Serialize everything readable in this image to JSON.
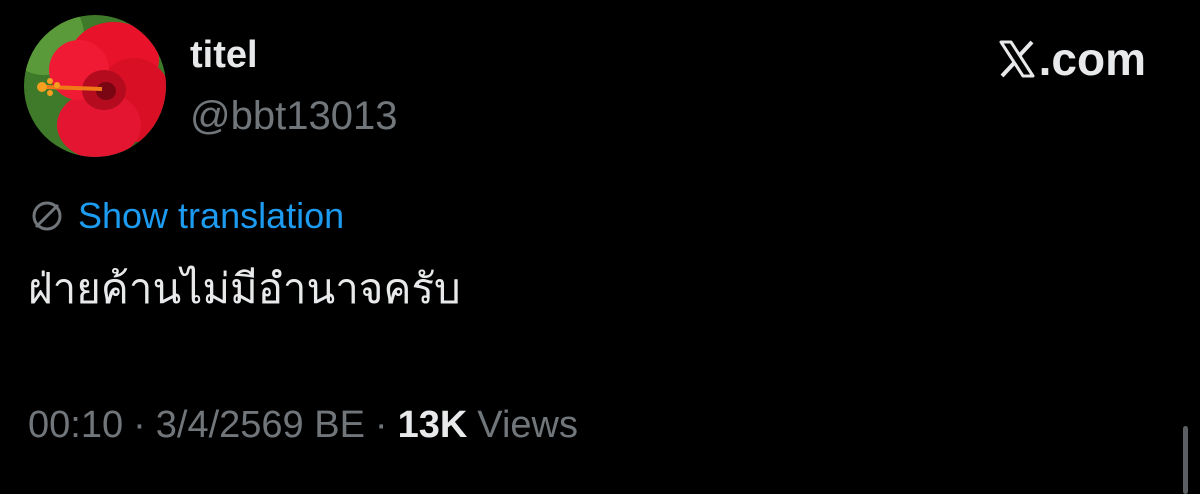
{
  "author": {
    "display_name": "titel",
    "handle": "@bbt13013",
    "avatar_icon": "hibiscus-flower-avatar"
  },
  "brand": {
    "label": ".com",
    "icon": "x-logo-icon"
  },
  "translation": {
    "icon": "globe-icon",
    "link_label": "Show translation"
  },
  "tweet": {
    "text": "ฝ่ายค้านไม่มีอำนาจครับ"
  },
  "meta": {
    "time": "00:10",
    "separator": "·",
    "date": "3/4/2569 BE",
    "views_count": "13K",
    "views_label": "Views"
  },
  "colors": {
    "background": "#000000",
    "primary_text": "#e7e9ea",
    "secondary_text": "#71767b",
    "link": "#1d9bf0"
  }
}
